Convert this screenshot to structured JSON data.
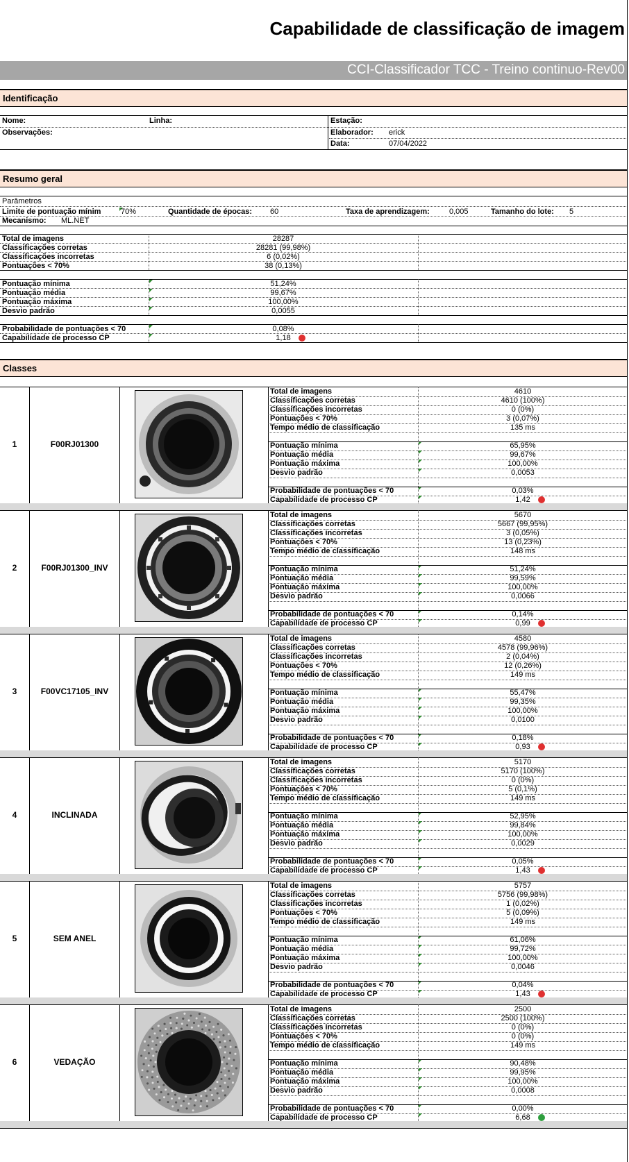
{
  "header": {
    "title": "Capabilidade de classificação de imagem",
    "subtitle": "CCI-Classificador TCC - Treino continuo-Rev00"
  },
  "identificacao": {
    "heading": "Identificação",
    "nome_label": "Nome:",
    "linha_label": "Linha:",
    "estacao_label": "Estação:",
    "observacoes_label": "Observações:",
    "elaborador_label": "Elaborador:",
    "elaborador_value": "erick",
    "data_label": "Data:",
    "data_value": "07/04/2022"
  },
  "resumo": {
    "heading": "Resumo geral",
    "parametros_label": "Parâmetros",
    "limite_label": "Limite de pontuação mínim",
    "limite_value": "70%",
    "epocas_label": "Quantidade de épocas:",
    "epocas_value": "60",
    "taxa_label": "Taxa de aprendizagem:",
    "taxa_value": "0,005",
    "lote_label": "Tamanho do lote:",
    "lote_value": "5",
    "mecanismo_label": "Mecanismo:",
    "mecanismo_value": "ML.NET",
    "rows1": [
      {
        "label": "Total de imagens",
        "value": "28287"
      },
      {
        "label": "Classificações corretas",
        "value": "28281 (99,98%)"
      },
      {
        "label": "Classificações incorretas",
        "value": "6 (0,02%)"
      },
      {
        "label": "Pontuações < 70%",
        "value": "38 (0,13%)"
      }
    ],
    "rows2": [
      {
        "label": "Pontuação mínima",
        "value": "51,24%"
      },
      {
        "label": "Pontuação média",
        "value": "99,67%"
      },
      {
        "label": "Pontuação máxima",
        "value": "100,00%"
      },
      {
        "label": "Desvio padrão",
        "value": "0,0055"
      }
    ],
    "rows3": [
      {
        "label": "Probabilidade de pontuações < 70",
        "value": "0,08%"
      },
      {
        "label": "Capabilidade de processo CP",
        "value": "1,18"
      }
    ],
    "cp_status_color": "#e03030"
  },
  "classes": {
    "heading": "Classes",
    "labels": {
      "total": "Total de imagens",
      "corretas": "Classificações corretas",
      "incorretas": "Classificações incorretas",
      "pont70": "Pontuações < 70%",
      "tempo": "Tempo médio de classificação",
      "min": "Pontuação mínima",
      "media": "Pontuação média",
      "max": "Pontuação máxima",
      "desvio": "Desvio padrão",
      "prob": "Probabilidade de pontuações < 70",
      "cp": "Capabilidade de processo CP"
    },
    "items": [
      {
        "num": "1",
        "name": "F00RJ01300",
        "image": "ring-thick-dark",
        "total": "4610",
        "corretas": "4610 (100%)",
        "incorretas": "0 (0%)",
        "pont70": "3 (0,07%)",
        "tempo": "135 ms",
        "min": "65,95%",
        "media": "99,67%",
        "max": "100,00%",
        "desvio": "0,0053",
        "prob": "0,03%",
        "cp": "1,42",
        "cp_color": "#e03030"
      },
      {
        "num": "2",
        "name": "F00RJ01300_INV",
        "image": "ring-with-bright-band",
        "total": "5670",
        "corretas": "5667 (99,95%)",
        "incorretas": "3 (0,05%)",
        "pont70": "13 (0,23%)",
        "tempo": "148 ms",
        "min": "51,24%",
        "media": "99,59%",
        "max": "100,00%",
        "desvio": "0,0066",
        "prob": "0,14%",
        "cp": "0,99",
        "cp_color": "#e03030"
      },
      {
        "num": "3",
        "name": "F00VC17105_INV",
        "image": "ring-bright-band-dark-bg",
        "total": "4580",
        "corretas": "4578 (99,96%)",
        "incorretas": "2 (0,04%)",
        "pont70": "12 (0,26%)",
        "tempo": "149 ms",
        "min": "55,47%",
        "media": "99,35%",
        "max": "100,00%",
        "desvio": "0,0100",
        "prob": "0,18%",
        "cp": "0,93",
        "cp_color": "#e03030"
      },
      {
        "num": "4",
        "name": "INCLINADA",
        "image": "ring-tilted",
        "total": "5170",
        "corretas": "5170 (100%)",
        "incorretas": "0 (0%)",
        "pont70": "5 (0,1%)",
        "tempo": "149 ms",
        "min": "52,95%",
        "media": "99,84%",
        "max": "100,00%",
        "desvio": "0,0029",
        "prob": "0,05%",
        "cp": "1,43",
        "cp_color": "#e03030"
      },
      {
        "num": "5",
        "name": "SEM ANEL",
        "image": "ring-no-ring",
        "total": "5757",
        "corretas": "5756 (99,98%)",
        "incorretas": "1 (0,02%)",
        "pont70": "5 (0,09%)",
        "tempo": "149 ms",
        "min": "61,06%",
        "media": "99,72%",
        "max": "100,00%",
        "desvio": "0,0046",
        "prob": "0,04%",
        "cp": "1,43",
        "cp_color": "#e03030"
      },
      {
        "num": "6",
        "name": "VEDAÇÃO",
        "image": "seal-textured",
        "total": "2500",
        "corretas": "2500 (100%)",
        "incorretas": "0 (0%)",
        "pont70": "0 (0%)",
        "tempo": "149 ms",
        "min": "90,48%",
        "media": "99,95%",
        "max": "100,00%",
        "desvio": "0,0008",
        "prob": "0,00%",
        "cp": "6,68",
        "cp_color": "#2e9e3e"
      }
    ]
  }
}
